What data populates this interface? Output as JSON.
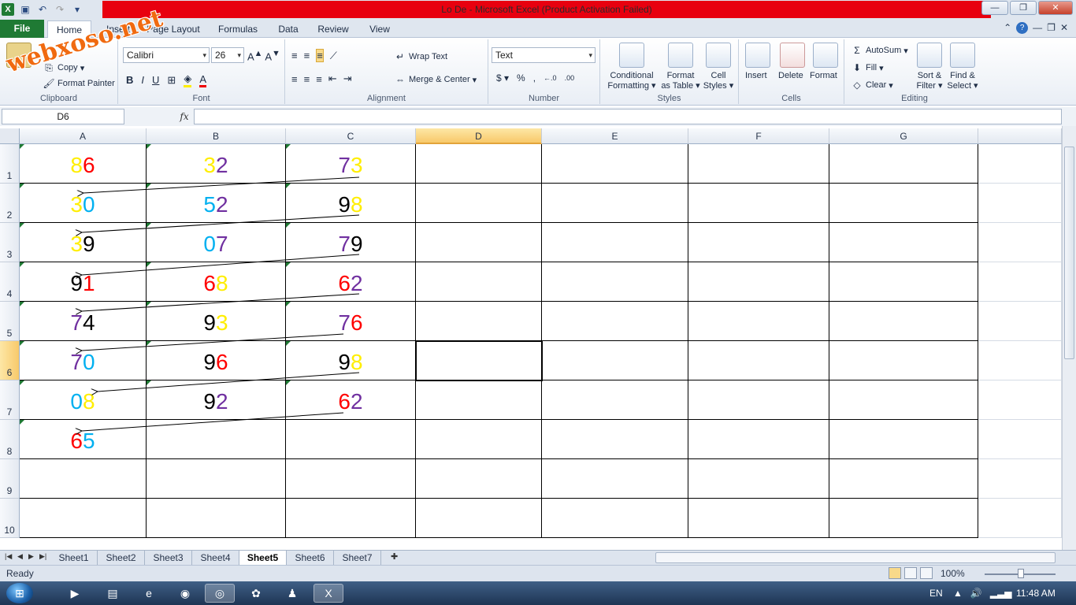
{
  "window": {
    "title": "Lo De  -  Microsoft Excel (Product Activation Failed)"
  },
  "watermark": "webxoso.net",
  "ribbon_tabs": [
    "File",
    "Home",
    "Insert",
    "Page Layout",
    "Formulas",
    "Data",
    "Review",
    "View"
  ],
  "clipboard": {
    "copy": "Copy",
    "format_painter": "Format Painter",
    "label": "Clipboard"
  },
  "font": {
    "name": "Calibri",
    "size": "26",
    "label": "Font"
  },
  "alignment": {
    "wrap_text": "Wrap Text",
    "merge_center": "Merge & Center",
    "label": "Alignment"
  },
  "number": {
    "format": "Text",
    "label": "Number"
  },
  "styles": {
    "conditional": "Conditional",
    "conditional2": "Formatting",
    "format_as": "Format",
    "format_as2": "as Table",
    "cell_styles": "Cell",
    "cell_styles2": "Styles",
    "label": "Styles"
  },
  "cells": {
    "insert": "Insert",
    "delete": "Delete",
    "format": "Format",
    "label": "Cells"
  },
  "editing": {
    "autosum": "AutoSum",
    "fill": "Fill",
    "clear": "Clear",
    "sort1": "Sort &",
    "sort2": "Filter",
    "find1": "Find &",
    "find2": "Select",
    "label": "Editing"
  },
  "formula_bar": {
    "name_box": "D6",
    "fx": "fx",
    "value": ""
  },
  "columns": [
    "A",
    "B",
    "C",
    "D",
    "E",
    "F",
    "G"
  ],
  "rows": [
    "1",
    "2",
    "3",
    "4",
    "5",
    "6",
    "7",
    "8",
    "9",
    "10"
  ],
  "cells_data": [
    [
      {
        "d1": "8",
        "c1": "#ffee00",
        "d2": "6",
        "c2": "#ff0000"
      },
      {
        "d1": "3",
        "c1": "#ffee00",
        "d2": "2",
        "c2": "#7030a0"
      },
      {
        "d1": "7",
        "c1": "#7030a0",
        "d2": "3",
        "c2": "#ffee00"
      }
    ],
    [
      {
        "d1": "3",
        "c1": "#ffee00",
        "d2": "0",
        "c2": "#00b0f0"
      },
      {
        "d1": "5",
        "c1": "#00b0f0",
        "d2": "2",
        "c2": "#7030a0"
      },
      {
        "d1": "9",
        "c1": "#000000",
        "d2": "8",
        "c2": "#ffee00"
      }
    ],
    [
      {
        "d1": "3",
        "c1": "#ffee00",
        "d2": "9",
        "c2": "#000000"
      },
      {
        "d1": "0",
        "c1": "#00b0f0",
        "d2": "7",
        "c2": "#7030a0"
      },
      {
        "d1": "7",
        "c1": "#7030a0",
        "d2": "9",
        "c2": "#000000"
      }
    ],
    [
      {
        "d1": "9",
        "c1": "#000000",
        "d2": "1",
        "c2": "#ff0000"
      },
      {
        "d1": "6",
        "c1": "#ff0000",
        "d2": "8",
        "c2": "#ffee00"
      },
      {
        "d1": "6",
        "c1": "#ff0000",
        "d2": "2",
        "c2": "#7030a0"
      }
    ],
    [
      {
        "d1": "7",
        "c1": "#7030a0",
        "d2": "4",
        "c2": "#000000"
      },
      {
        "d1": "9",
        "c1": "#000000",
        "d2": "3",
        "c2": "#ffee00"
      },
      {
        "d1": "7",
        "c1": "#7030a0",
        "d2": "6",
        "c2": "#ff0000"
      }
    ],
    [
      {
        "d1": "7",
        "c1": "#7030a0",
        "d2": "0",
        "c2": "#00b0f0"
      },
      {
        "d1": "9",
        "c1": "#000000",
        "d2": "6",
        "c2": "#ff0000"
      },
      {
        "d1": "9",
        "c1": "#000000",
        "d2": "8",
        "c2": "#ffee00"
      }
    ],
    [
      {
        "d1": "0",
        "c1": "#00b0f0",
        "d2": "8",
        "c2": "#ffee00"
      },
      {
        "d1": "9",
        "c1": "#000000",
        "d2": "2",
        "c2": "#7030a0"
      },
      {
        "d1": "6",
        "c1": "#ff0000",
        "d2": "2",
        "c2": "#7030a0"
      }
    ],
    [
      {
        "d1": "6",
        "c1": "#ff0000",
        "d2": "5",
        "c2": "#00b0f0"
      },
      null,
      null
    ]
  ],
  "selected_cell": "D6",
  "sheets": [
    "Sheet1",
    "Sheet2",
    "Sheet3",
    "Sheet4",
    "Sheet5",
    "Sheet6",
    "Sheet7"
  ],
  "active_sheet": "Sheet5",
  "status": {
    "ready": "Ready",
    "zoom": "100%"
  },
  "taskbar": {
    "lang": "EN",
    "time": "11:48 AM"
  }
}
